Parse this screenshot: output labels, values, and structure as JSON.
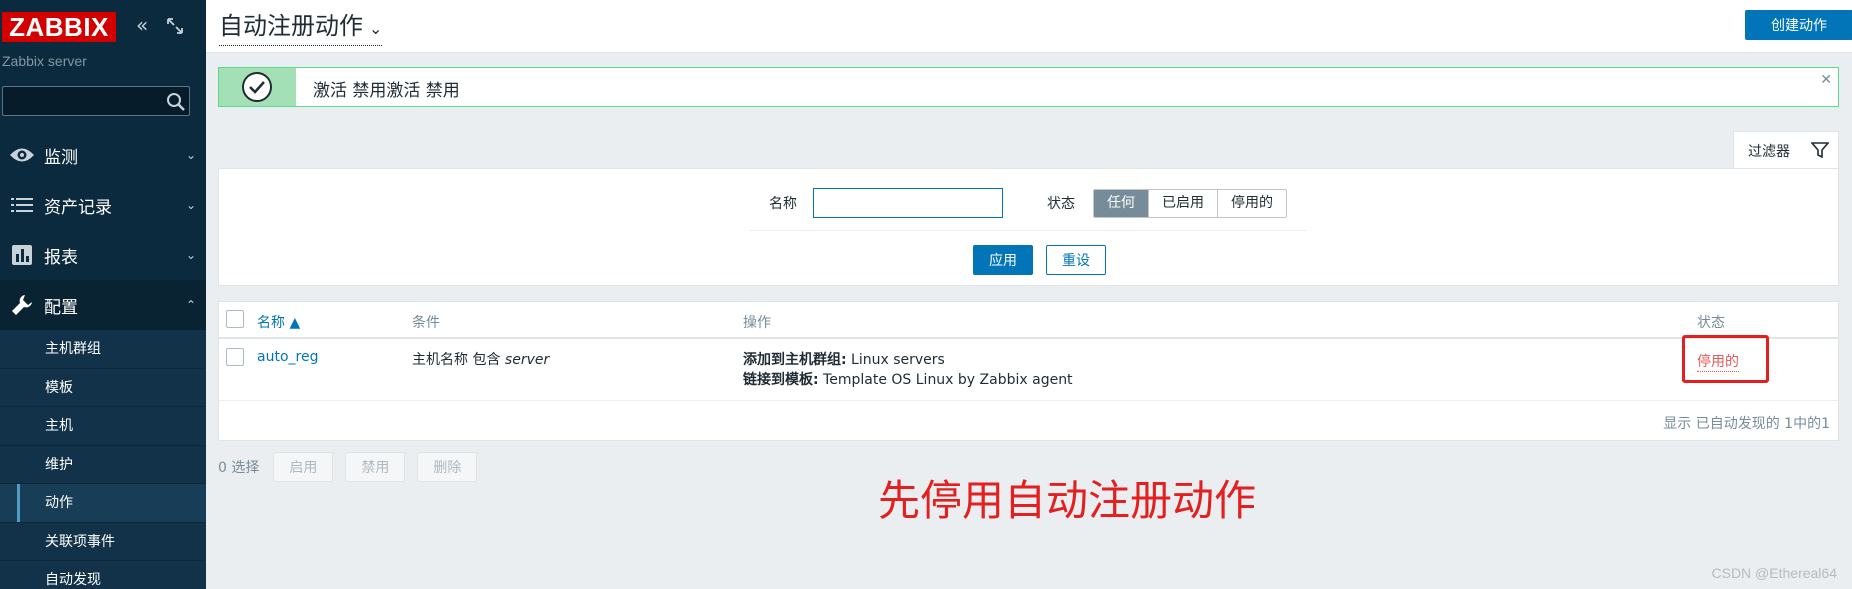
{
  "sidebar": {
    "logo": "ZABBIX",
    "server_name": "Zabbix server",
    "menu": [
      {
        "label": "监测",
        "icon": "eye-icon"
      },
      {
        "label": "资产记录",
        "icon": "list-icon"
      },
      {
        "label": "报表",
        "icon": "bar-chart-icon"
      },
      {
        "label": "配置",
        "icon": "wrench-icon"
      }
    ],
    "submenu": [
      "主机群组",
      "模板",
      "主机",
      "维护",
      "动作",
      "关联项事件",
      "自动发现"
    ]
  },
  "header": {
    "title": "自动注册动作",
    "create_button": "创建动作"
  },
  "message": {
    "text": "激活 禁用激活 禁用"
  },
  "filter": {
    "tab_label": "过滤器",
    "name_label": "名称",
    "name_value": "",
    "status_label": "状态",
    "status_options": [
      "任何",
      "已启用",
      "停用的"
    ],
    "status_selected": "任何",
    "apply": "应用",
    "reset": "重设"
  },
  "table": {
    "headers": {
      "name": "名称 ▲",
      "conditions": "条件",
      "operations": "操作",
      "status": "状态"
    },
    "rows": [
      {
        "name": "auto_reg",
        "condition_prefix": "主机名称 包含 ",
        "condition_value": "server",
        "op1_label": "添加到主机群组:",
        "op1_value": " Linux servers",
        "op2_label": "链接到模板:",
        "op2_value": " Template OS Linux by Zabbix agent",
        "status": "停用的"
      }
    ],
    "footer": "显示 已自动发现的 1中的1"
  },
  "mass_actions": {
    "selected": "0 选择",
    "enable": "启用",
    "disable": "禁用",
    "delete": "删除"
  },
  "annotation": "先停用自动注册动作",
  "watermark": "CSDN @Ethereal64",
  "colors": {
    "accent": "#0275b8",
    "danger": "#e45959",
    "annotation": "#e31f1f",
    "sidebar": "#0c2a3d"
  }
}
